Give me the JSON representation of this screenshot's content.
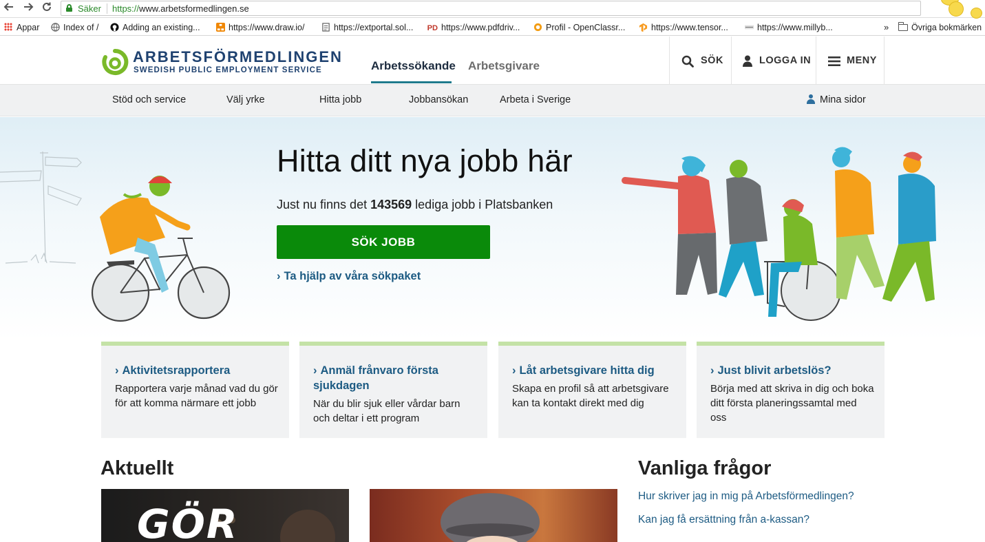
{
  "browser": {
    "secure_label": "Säker",
    "url_protocol": "https://",
    "url_host": "www.arbetsformedlingen.se",
    "bookmarks": [
      {
        "label": "Appar",
        "icon": "apps-grid-icon"
      },
      {
        "label": "Index of /",
        "icon": "globe-icon"
      },
      {
        "label": "Adding an existing...",
        "icon": "github-icon"
      },
      {
        "label": "https://www.draw.io/",
        "icon": "drawio-icon"
      },
      {
        "label": "https://extportal.sol...",
        "icon": "document-icon"
      },
      {
        "label": "https://www.pdfdriv...",
        "icon": "pdfdrive-icon"
      },
      {
        "label": "Profil - OpenClassr...",
        "icon": "openclassrooms-icon"
      },
      {
        "label": "https://www.tensor...",
        "icon": "tensorflow-icon"
      },
      {
        "label": "https://www.millyb...",
        "icon": "millyb-icon"
      }
    ],
    "overflow": "»",
    "other_bookmarks": "Övriga bokmärken"
  },
  "header": {
    "logo_name": "ARBETSFÖRMEDLINGEN",
    "logo_sub": "SWEDISH PUBLIC EMPLOYMENT SERVICE",
    "tabs": [
      {
        "label": "Arbetssökande",
        "active": true
      },
      {
        "label": "Arbetsgivare",
        "active": false
      }
    ],
    "search_label": "SÖK",
    "login_label": "LOGGA IN",
    "menu_label": "MENY"
  },
  "subnav": {
    "items": [
      {
        "label": "Stöd och service"
      },
      {
        "label": "Välj yrke"
      },
      {
        "label": "Hitta jobb"
      },
      {
        "label": "Jobbansökan"
      },
      {
        "label": "Arbeta i Sverige"
      }
    ],
    "my_pages": "Mina sidor"
  },
  "hero": {
    "title": "Hitta ditt nya jobb här",
    "sub_prefix": "Just nu finns det ",
    "job_count": "143569",
    "sub_suffix": " lediga jobb i Platsbanken",
    "cta_label": "SÖK JOBB",
    "help_link": "Ta hjälp av våra sökpaket"
  },
  "cards": [
    {
      "title": "Aktivitetsrapportera",
      "text": "Rapportera varje månad vad du gör för att komma närmare ett jobb"
    },
    {
      "title": "Anmäl frånvaro första sjukdagen",
      "text": "När du blir sjuk eller vårdar barn och deltar i ett program"
    },
    {
      "title": "Låt arbetsgivare hitta dig",
      "text": "Skapa en profil så att arbetsgivare kan ta kontakt direkt med dig"
    },
    {
      "title": "Just blivit arbetslös?",
      "text": "Börja med att skriva in dig och boka ditt första planeringssamtal med oss"
    }
  ],
  "news": {
    "heading": "Aktuellt",
    "image1_text": "GÖR"
  },
  "faq": {
    "heading": "Vanliga frågor",
    "items": [
      "Hur skriver jag in mig på Arbetsförmedlingen?",
      "Kan jag få ersättning från a-kassan?"
    ]
  },
  "colors": {
    "brand_green": "#0a8a0a",
    "brand_navy": "#1f4270",
    "link_blue": "#1d5b83",
    "card_accent": "#c4e2a6",
    "logo_green": "#7ab929"
  }
}
